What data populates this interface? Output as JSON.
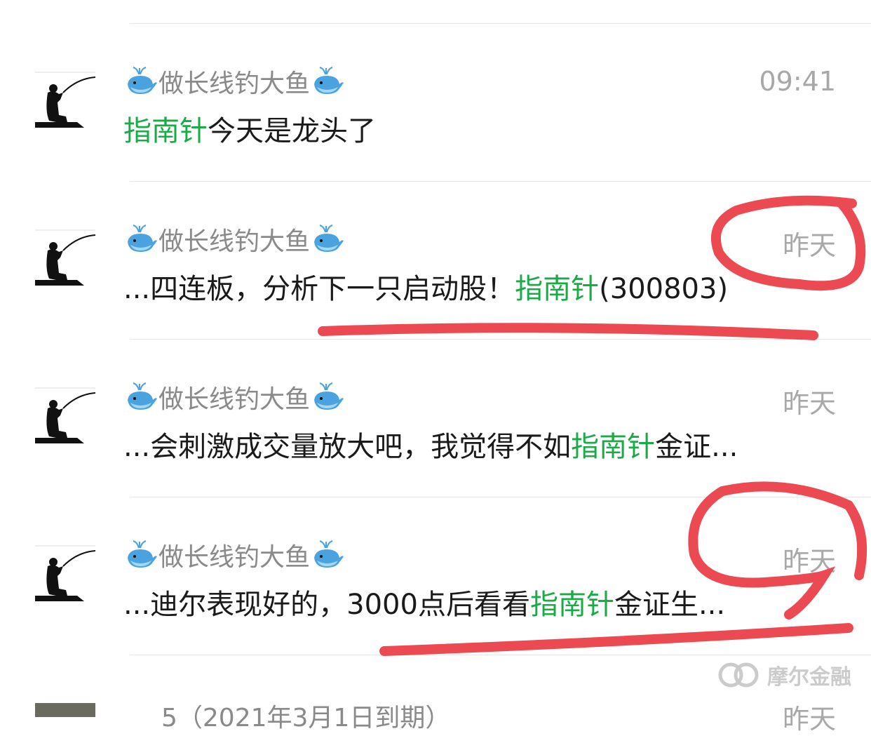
{
  "rows": [
    {
      "name": "做长线钓大鱼",
      "time": "09:41",
      "message": {
        "prefix": "",
        "keyword": "指南针",
        "suffix": "今天是龙头了"
      }
    },
    {
      "name": "做长线钓大鱼",
      "time": "昨天",
      "message": {
        "prefix": "...四连板，分析下一只启动股！",
        "keyword": "指南针",
        "suffix": "(300803)"
      }
    },
    {
      "name": "做长线钓大鱼",
      "time": "昨天",
      "message": {
        "prefix": "...会刺激成交量放大吧，我觉得不如",
        "keyword": "指南针",
        "suffix": "金证..."
      }
    },
    {
      "name": "做长线钓大鱼",
      "time": "昨天",
      "message": {
        "prefix": "...迪尔表现好的，3000点后看看",
        "keyword": "指南针",
        "suffix": "金证生..."
      }
    }
  ],
  "partial_row": {
    "name_partial": "5（2021年3月1日到期）",
    "time_partial": "昨天"
  },
  "watermark": {
    "text": "摩尔金融"
  },
  "colors": {
    "keyword": "#1aab46",
    "annotation": "#ec4a52",
    "time": "#a8a8a8",
    "name": "#8a8a8a"
  }
}
